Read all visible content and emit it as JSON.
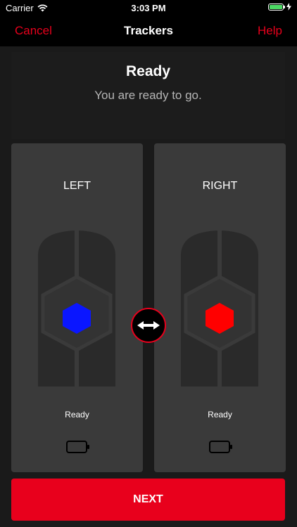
{
  "status_bar": {
    "carrier": "Carrier",
    "time": "3:03 PM"
  },
  "nav": {
    "cancel_label": "Cancel",
    "title": "Trackers",
    "help_label": "Help"
  },
  "header": {
    "title": "Ready",
    "subtitle": "You are ready to go."
  },
  "trackers": [
    {
      "label": "LEFT",
      "status": "Ready",
      "color": "#0a16ff"
    },
    {
      "label": "RIGHT",
      "status": "Ready",
      "color": "#ff0000"
    }
  ],
  "next_label": "NEXT",
  "colors": {
    "accent": "#e8001c",
    "card": "#3a3a3a",
    "background": "#1a1a1a"
  }
}
